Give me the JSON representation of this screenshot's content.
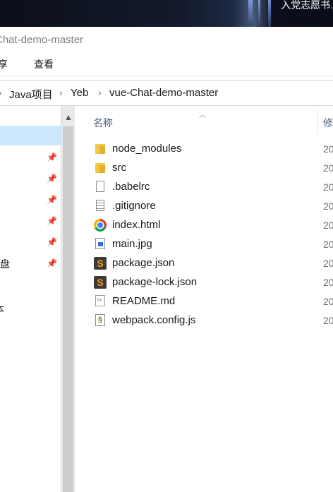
{
  "desktop": {
    "overlay_text": "入党志愿书.",
    "accent": "#1d2a44"
  },
  "window": {
    "title": "Chat-demo-master"
  },
  "ribbon": {
    "tabs": [
      {
        "label": "享"
      },
      {
        "label": "查看"
      }
    ]
  },
  "address": {
    "crumbs": [
      {
        "label": "Java项目"
      },
      {
        "label": "Yeb"
      },
      {
        "label": "vue-Chat-demo-master"
      }
    ],
    "separator_icon": "chevron-right-icon"
  },
  "navpane": {
    "labels": [
      {
        "label": "盘"
      },
      {
        "label": "本"
      }
    ],
    "pin_icon": "pin-icon",
    "selected_color": "#cce8ff"
  },
  "filelist": {
    "columns": {
      "name": "名称",
      "modified": "修"
    },
    "files": [
      {
        "name": "node_modules",
        "date": "20",
        "icon": "folder-icon"
      },
      {
        "name": "src",
        "date": "20",
        "icon": "folder-icon"
      },
      {
        "name": ".babelrc",
        "date": "20",
        "icon": "file-icon"
      },
      {
        "name": ".gitignore",
        "date": "20",
        "icon": "text-file-icon"
      },
      {
        "name": "index.html",
        "date": "20",
        "icon": "chrome-icon"
      },
      {
        "name": "main.jpg",
        "date": "20",
        "icon": "image-icon"
      },
      {
        "name": "package.json",
        "date": "20",
        "icon": "sublime-icon"
      },
      {
        "name": "package-lock.json",
        "date": "20",
        "icon": "sublime-icon"
      },
      {
        "name": "README.md",
        "date": "20",
        "icon": "markdown-icon"
      },
      {
        "name": "webpack.config.js",
        "date": "20",
        "icon": "js-file-icon"
      }
    ]
  },
  "colors": {
    "folder": "#f3c844",
    "header_text": "#4c607a",
    "selection": "#cce8ff"
  }
}
